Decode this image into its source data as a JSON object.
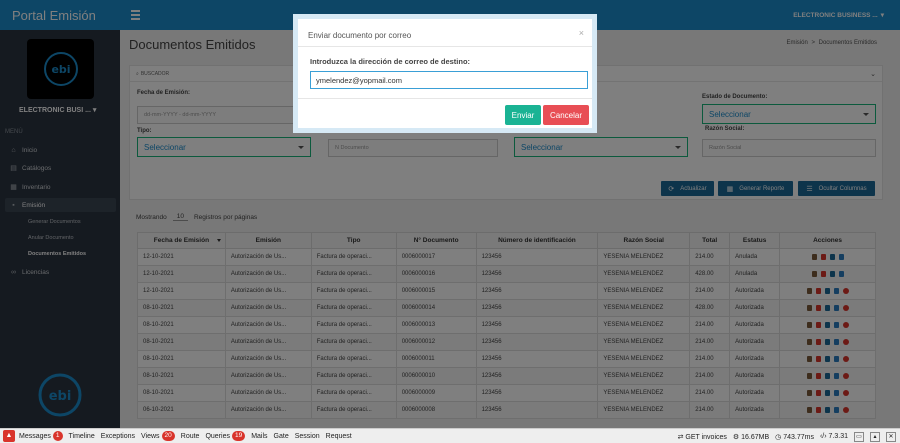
{
  "app": {
    "title": "Portal Emisión",
    "company_top": "ELECTRONIC BUSINESS ...",
    "company_side": "ELECTRONIC BUSI ..."
  },
  "sidebar": {
    "menu_header": "MENÚ",
    "items": [
      {
        "label": "Inicio",
        "icon": "home-icon"
      },
      {
        "label": "Catálogos",
        "icon": "book-icon"
      },
      {
        "label": "Inventario",
        "icon": "cubes-icon"
      },
      {
        "label": "Emisión",
        "icon": "file-icon"
      },
      {
        "label": "Licencias",
        "icon": "link-icon"
      }
    ],
    "subitems": [
      "Generar Documentos",
      "Anular Documento",
      "Documentos Emitidos"
    ]
  },
  "page": {
    "title": "Documentos Emitidos",
    "breadcrumb": [
      "Emisión",
      ">",
      "Documentos Emitidos"
    ]
  },
  "filters": {
    "panel_title": "BUSCADOR",
    "fecha_label": "Fecha de Emisión:",
    "fecha_placeholder": "dd-mm-YYYY - dd-mm-YYYY",
    "tipo_label": "Tipo:",
    "tipo_value": "Seleccionar",
    "ndoc_placeholder": "N Documento",
    "estatus_tipo_value": "Seleccionar",
    "estado_label": "Estado de Documento:",
    "estado_value": "Seleccionar",
    "razon_label": "Razón Social:",
    "razon_placeholder": "Razón Social"
  },
  "toolbar": {
    "actualizar": "Actualizar",
    "generar_reporte": "Generar Reporte",
    "ocultar_columnas": "Ocultar Columnas"
  },
  "pagination": {
    "showing_label": "Mostrando",
    "page_size": "10",
    "records_label": "Registros por páginas"
  },
  "table": {
    "headers": [
      "Fecha de Emisión",
      "Emisión",
      "Tipo",
      "N° Documento",
      "Número de identificación",
      "Razón Social",
      "Total",
      "Estatus",
      "Acciones"
    ],
    "rows": [
      [
        "12-10-2021",
        "Autorización de Us...",
        "Factura de operaci...",
        "0006000017",
        "123456",
        "YESENIA MELENDEZ",
        "214.00",
        "Anulada"
      ],
      [
        "12-10-2021",
        "Autorización de Us...",
        "Factura de operaci...",
        "0006000016",
        "123456",
        "YESENIA MELENDEZ",
        "428.00",
        "Anulada"
      ],
      [
        "12-10-2021",
        "Autorización de Us...",
        "Factura de operaci...",
        "0006000015",
        "123456",
        "YESENIA MELENDEZ",
        "214.00",
        "Autorizada"
      ],
      [
        "08-10-2021",
        "Autorización de Us...",
        "Factura de operaci...",
        "0006000014",
        "123456",
        "YESENIA MELENDEZ",
        "428.00",
        "Autorizada"
      ],
      [
        "08-10-2021",
        "Autorización de Us...",
        "Factura de operaci...",
        "0006000013",
        "123456",
        "YESENIA MELENDEZ",
        "214.00",
        "Autorizada"
      ],
      [
        "08-10-2021",
        "Autorización de Us...",
        "Factura de operaci...",
        "0006000012",
        "123456",
        "YESENIA MELENDEZ",
        "214.00",
        "Autorizada"
      ],
      [
        "08-10-2021",
        "Autorización de Us...",
        "Factura de operaci...",
        "0006000011",
        "123456",
        "YESENIA MELENDEZ",
        "214.00",
        "Autorizada"
      ],
      [
        "08-10-2021",
        "Autorización de Us...",
        "Factura de operaci...",
        "0006000010",
        "123456",
        "YESENIA MELENDEZ",
        "214.00",
        "Autorizada"
      ],
      [
        "08-10-2021",
        "Autorización de Us...",
        "Factura de operaci...",
        "0006000009",
        "123456",
        "YESENIA MELENDEZ",
        "214.00",
        "Autorizada"
      ],
      [
        "06-10-2021",
        "Autorización de Us...",
        "Factura de operaci...",
        "0006000008",
        "123456",
        "YESENIA MELENDEZ",
        "214.00",
        "Autorizada"
      ]
    ]
  },
  "modal": {
    "title": "Enviar documento por correo",
    "close": "×",
    "label": "Introduzca la dirección de correo de destino:",
    "email_value": "ymelendez@yopmail.com",
    "send": "Enviar",
    "cancel": "Cancelar"
  },
  "debugbar": {
    "messages": "Messages",
    "messages_count": "1",
    "timeline": "Timeline",
    "exceptions": "Exceptions",
    "views": "Views",
    "views_count": "20",
    "route": "Route",
    "queries": "Queries",
    "queries_count": "19",
    "mails": "Mails",
    "gate": "Gate",
    "session": "Session",
    "request": "Request",
    "request_info": "GET invoices",
    "memory": "16.67MB",
    "time": "743.77ms",
    "php_version": "7.3.31"
  },
  "colors": {
    "primary": "#1a8ccc",
    "sidebar": "#2b3440",
    "accent_green": "#1ab394",
    "danger": "#e84e55",
    "button_dark": "#1b6896"
  }
}
